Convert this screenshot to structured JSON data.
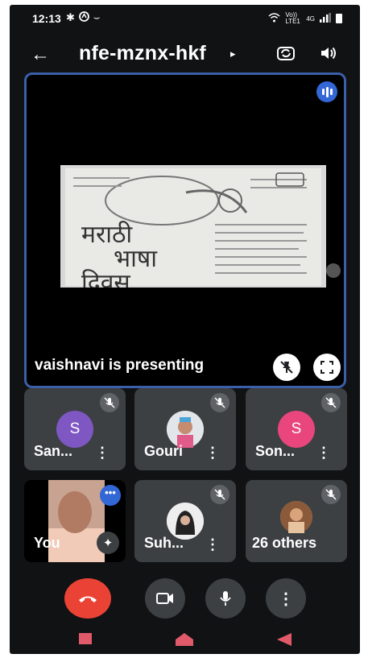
{
  "status_bar": {
    "time": "12:13",
    "network_label": "Vo)) LTE1",
    "network_type": "4G"
  },
  "header": {
    "meeting_code": "nfe-mznx-hkf"
  },
  "stage": {
    "presenting_text": "vaishnavi is presenting",
    "poster_text_line1": "मराठी",
    "poster_text_line2": "भाषा",
    "poster_text_line3": "दिवस"
  },
  "participants": [
    {
      "name": "San...",
      "initial": "S",
      "avatar_color": "#7e57c2",
      "muted": true
    },
    {
      "name": "Gouri",
      "initial": "",
      "avatar_color": "#d7d7d7",
      "muted": true
    },
    {
      "name": "Son...",
      "initial": "S",
      "avatar_color": "#e8467c",
      "muted": true
    },
    {
      "name": "You",
      "initial": "",
      "avatar_color": "#c9a391",
      "muted": false
    },
    {
      "name": "Suh...",
      "initial": "",
      "avatar_color": "#e6e6e6",
      "muted": true
    },
    {
      "name": "26 others",
      "initial": "",
      "avatar_color": "#c89b75",
      "muted": true
    }
  ],
  "colors": {
    "accent": "#3367d6",
    "hangup": "#ea4335",
    "tile_bg": "#3c4043",
    "stage_border": "#3b5fa8"
  },
  "icons": {
    "back": "arrow-left-icon",
    "flip_camera": "flip-camera-icon",
    "speaker": "speaker-icon",
    "mic_off": "mic-off-icon",
    "camera": "camera-icon",
    "mic": "mic-icon",
    "more": "more-vertical-icon",
    "end_call": "end-call-icon",
    "pin": "pin-off-icon",
    "fullscreen": "fullscreen-icon"
  }
}
